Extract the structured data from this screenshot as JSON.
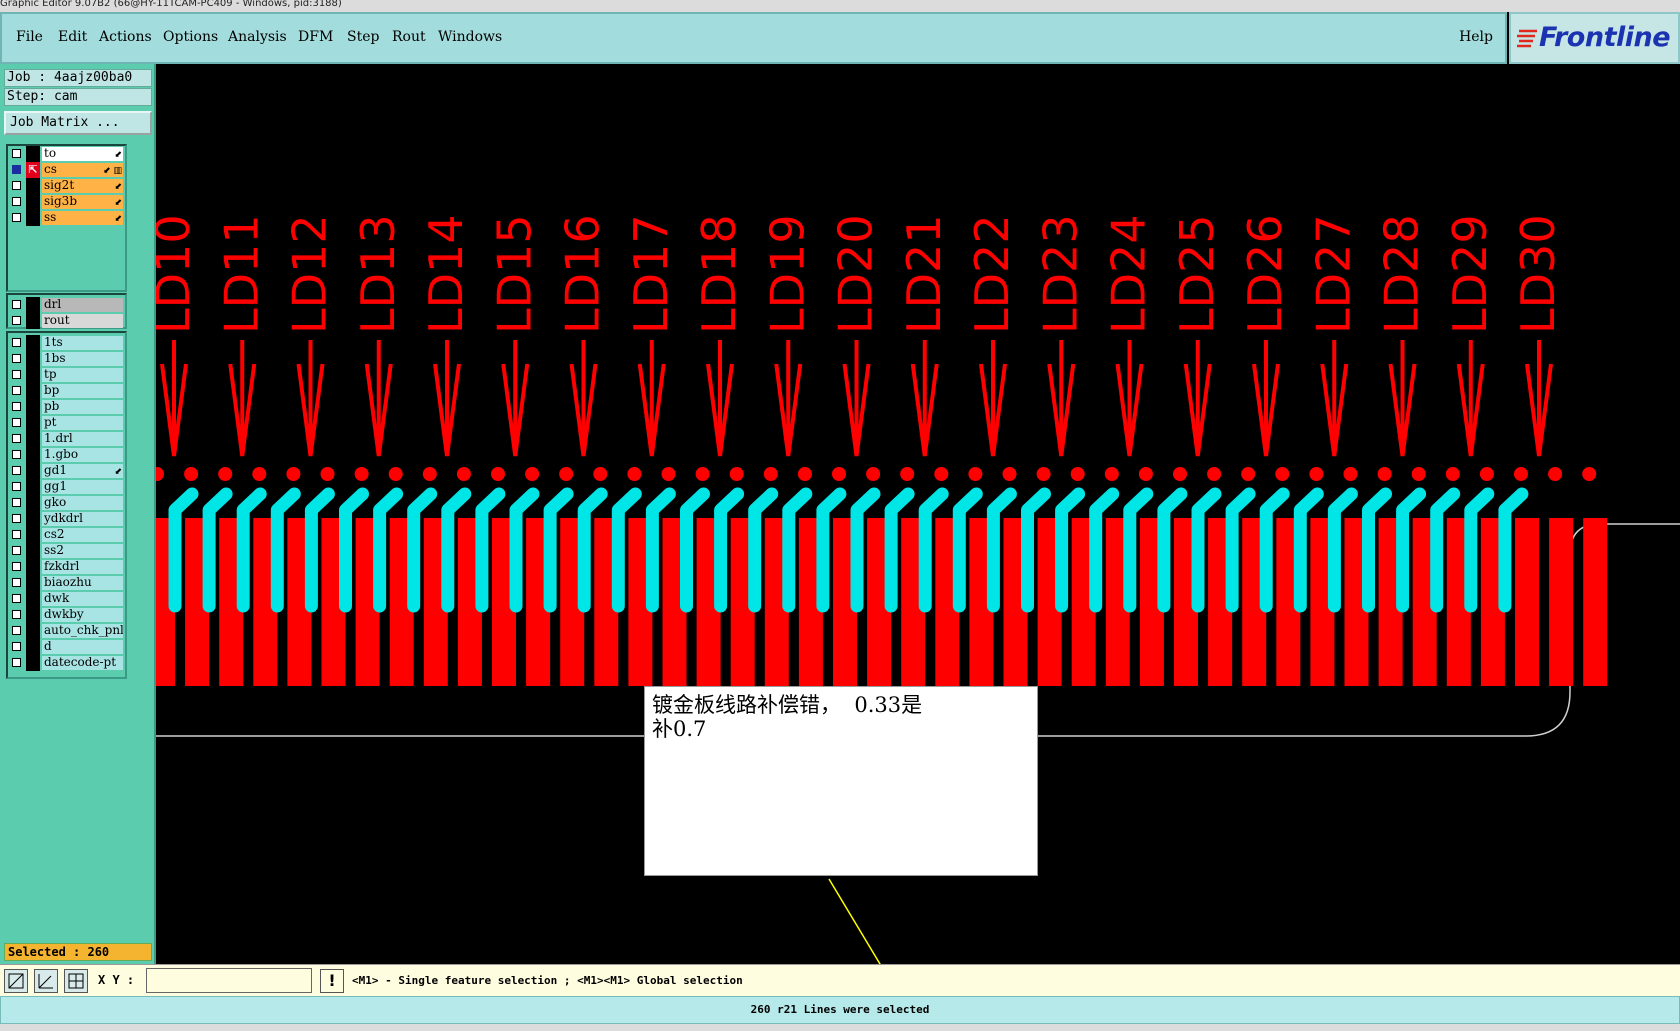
{
  "window": {
    "title": "Graphic Editor 9.07B2 (66@HY-11TCAM-PC409 - Windows, pid:3188)"
  },
  "menu": {
    "items": [
      {
        "label": "File"
      },
      {
        "label": "Edit"
      },
      {
        "label": "Actions"
      },
      {
        "label": "Options"
      },
      {
        "label": "Analysis"
      },
      {
        "label": "DFM"
      },
      {
        "label": "Step"
      },
      {
        "label": "Rout"
      },
      {
        "label": "Windows"
      }
    ],
    "help": "Help"
  },
  "logo": {
    "text": "Frontline"
  },
  "job": {
    "job_text": "Job : 4aajz00ba0",
    "step_text": "Step: cam",
    "matrix_label": "Job Matrix ..."
  },
  "layers": {
    "group1": [
      {
        "name": "to",
        "ext": "⬋"
      },
      {
        "name": "cs",
        "ext": "⬋ ▥",
        "active": true
      },
      {
        "name": "sig2t",
        "ext": "⬋"
      },
      {
        "name": "sig3b",
        "ext": "⬋"
      },
      {
        "name": "ss",
        "ext": "⬋"
      }
    ],
    "group2": [
      {
        "name": "drl"
      },
      {
        "name": "rout"
      }
    ],
    "group3": [
      {
        "name": "1ts"
      },
      {
        "name": "1bs"
      },
      {
        "name": "tp"
      },
      {
        "name": "bp"
      },
      {
        "name": "pb"
      },
      {
        "name": "pt"
      },
      {
        "name": "1.drl"
      },
      {
        "name": "1.gbo"
      },
      {
        "name": "gd1",
        "ext": "⬋"
      },
      {
        "name": "gg1"
      },
      {
        "name": "gko"
      },
      {
        "name": "ydkdrl"
      },
      {
        "name": "cs2"
      },
      {
        "name": "ss2"
      },
      {
        "name": "fzkdrl"
      },
      {
        "name": "biaozhu"
      },
      {
        "name": "dwk"
      },
      {
        "name": "dwkby"
      },
      {
        "name": "auto_chk_pnl"
      },
      {
        "name": "d"
      },
      {
        "name": "datecode-pt"
      }
    ]
  },
  "selected": {
    "text": "Selected : 260"
  },
  "canvas": {
    "labels": [
      "LD10",
      "LD11",
      "LD12",
      "LD13",
      "LD14",
      "LD15",
      "LD16",
      "LD17",
      "LD18",
      "LD19",
      "LD20",
      "LD21",
      "LD22",
      "LD23",
      "LD24",
      "LD25",
      "LD26",
      "LD27",
      "LD28",
      "LD29",
      "LD30"
    ],
    "colors": {
      "copper": "#ff0000",
      "trace": "#00e5e5",
      "outline": "#d0d0d0",
      "background": "#000000"
    }
  },
  "note": {
    "text": "镀金板线路补偿错，  0.33是\n补0.7"
  },
  "command": {
    "xy_label": "X Y :",
    "xy_value": "",
    "excl": "!",
    "hint": "<M1> - Single feature selection ; <M1><M1> Global selection"
  },
  "status": {
    "text": "260 r21 Lines were selected"
  }
}
